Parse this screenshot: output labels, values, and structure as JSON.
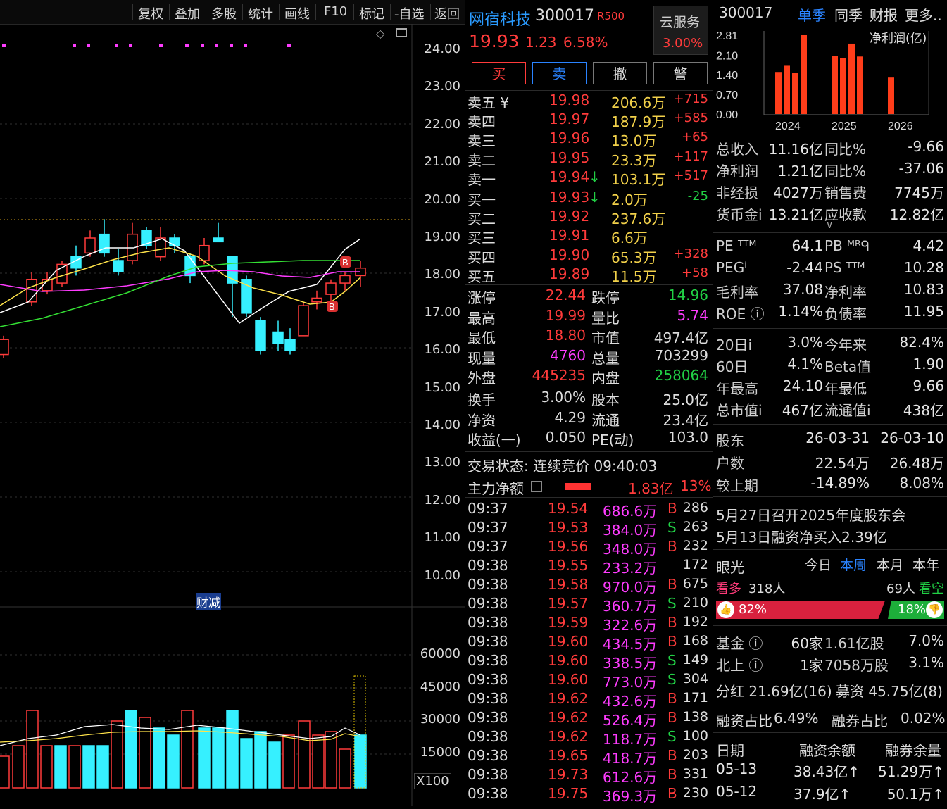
{
  "toolbar": {
    "items": [
      "复权",
      "叠加",
      "多股",
      "统计",
      "画线",
      "F10",
      "标记",
      "-自选",
      "返回"
    ]
  },
  "chart": {
    "price_ticks": [
      "24.00",
      "23.00",
      "22.00",
      "21.00",
      "20.00",
      "19.00",
      "18.00",
      "17.00",
      "16.00",
      "15.00",
      "14.00",
      "13.00",
      "12.00",
      "11.00",
      "10.00"
    ],
    "volume_ticks": [
      "60000",
      "45000",
      "30000",
      "15000"
    ],
    "volume_unit": "X100",
    "event_label": "财减",
    "markers": [
      "B",
      "B"
    ],
    "colors": {
      "up": "#ff3b3b",
      "down": "#36f0ff",
      "ma5": "#ffffff",
      "ma10": "#ffe34a",
      "ma20": "#ff3cff",
      "ma60": "#34e034"
    }
  },
  "quote": {
    "name": "网宿科技",
    "code": "300017",
    "badge": "R500",
    "price": "19.93",
    "change": "1.23",
    "change_pct": "6.58%",
    "cloud_label": "云服务",
    "cloud_pct": "3.00%",
    "buttons": [
      "买",
      "卖",
      "撤",
      "警"
    ],
    "asks": [
      {
        "label": "卖五 ¥",
        "price": "19.98",
        "vol": "206.6万",
        "chg": "+715",
        "arrow": ""
      },
      {
        "label": "卖四",
        "price": "19.97",
        "vol": "187.9万",
        "chg": "+585",
        "arrow": ""
      },
      {
        "label": "卖三",
        "price": "19.96",
        "vol": "13.0万",
        "chg": "+65",
        "arrow": ""
      },
      {
        "label": "卖二",
        "price": "19.95",
        "vol": "23.3万",
        "chg": "+117",
        "arrow": ""
      },
      {
        "label": "卖一",
        "price": "19.94",
        "vol": "103.1万",
        "chg": "+517",
        "arrow": "↓"
      }
    ],
    "bids": [
      {
        "label": "买一",
        "price": "19.93",
        "vol": "2.0万",
        "chg": "-25",
        "arrow": "↓"
      },
      {
        "label": "买二",
        "price": "19.92",
        "vol": "237.6万",
        "chg": "",
        "arrow": ""
      },
      {
        "label": "买三",
        "price": "19.91",
        "vol": "6.6万",
        "chg": "",
        "arrow": ""
      },
      {
        "label": "买四",
        "price": "19.90",
        "vol": "65.3万",
        "chg": "+328",
        "arrow": ""
      },
      {
        "label": "买五",
        "price": "19.89",
        "vol": "11.5万",
        "chg": "+58",
        "arrow": ""
      }
    ],
    "stats": [
      [
        "涨停",
        "22.44",
        "跌停",
        "14.96"
      ],
      [
        "最高",
        "19.99",
        "量比",
        "5.74"
      ],
      [
        "最低",
        "18.80",
        "市值",
        "497.4亿"
      ],
      [
        "现量",
        "4760",
        "总量",
        "703299"
      ],
      [
        "外盘",
        "445235",
        "内盘",
        "258064"
      ]
    ],
    "stats2": [
      [
        "换手",
        "3.00%",
        "股本",
        "25.0亿"
      ],
      [
        "净资",
        "4.29",
        "流通",
        "23.4亿"
      ],
      [
        "收益(一)",
        "0.050",
        "PE(动)",
        "103.0"
      ]
    ],
    "trade_status": "交易状态: 连续竞价 09:40:03",
    "main_flow_label": "主力净额",
    "main_flow_value": "1.83亿",
    "main_flow_pct": "13%",
    "ticks": [
      [
        "09:37",
        "19.54",
        "686.6万",
        "B",
        "286"
      ],
      [
        "09:37",
        "19.53",
        "384.0万",
        "S",
        "263"
      ],
      [
        "09:37",
        "19.56",
        "348.0万",
        "B",
        "232"
      ],
      [
        "09:38",
        "19.55",
        "233.2万",
        "",
        "172"
      ],
      [
        "09:38",
        "19.58",
        "970.0万",
        "B",
        "675"
      ],
      [
        "09:38",
        "19.57",
        "360.7万",
        "S",
        "210"
      ],
      [
        "09:38",
        "19.59",
        "322.6万",
        "B",
        "192"
      ],
      [
        "09:38",
        "19.60",
        "434.5万",
        "B",
        "168"
      ],
      [
        "09:38",
        "19.60",
        "338.5万",
        "S",
        "149"
      ],
      [
        "09:38",
        "19.60",
        "773.0万",
        "S",
        "304"
      ],
      [
        "09:38",
        "19.62",
        "432.6万",
        "B",
        "171"
      ],
      [
        "09:38",
        "19.62",
        "526.4万",
        "B",
        "138"
      ],
      [
        "09:38",
        "19.62",
        "118.7万",
        "S",
        "100"
      ],
      [
        "09:38",
        "19.65",
        "418.7万",
        "B",
        "203"
      ],
      [
        "09:38",
        "19.73",
        "612.6万",
        "B",
        "331"
      ],
      [
        "09:38",
        "19.75",
        "369.3万",
        "B",
        "230"
      ]
    ]
  },
  "fin": {
    "code": "300017",
    "tabs": [
      "单季",
      "同季",
      "财报",
      "更多.."
    ],
    "chart_label": "净利润(亿)",
    "y_ticks": [
      "2.81",
      "2.10",
      "1.40",
      "0.70",
      "0.00"
    ],
    "x_ticks": [
      "2024",
      "2025",
      "2026"
    ],
    "rows": [
      [
        "总收入",
        "11.16亿",
        "同比%",
        "-9.66"
      ],
      [
        "净利润",
        "1.21亿",
        "同比%",
        "-37.06"
      ],
      [
        "非经损",
        "4027万",
        "销售费",
        "7745万"
      ],
      [
        "货币金i",
        "13.21亿",
        "应收款",
        "12.82亿"
      ]
    ],
    "val_rows": [
      [
        "PE ᵀᵀᴹ",
        "64.1",
        "PB ᴹᴿᑫ",
        "4.42"
      ],
      [
        "PEGⁱ",
        "-2.44",
        "PS ᵀᵀᴹ",
        "10.28"
      ],
      [
        "毛利率",
        "37.08",
        "净利率",
        "10.83"
      ],
      [
        "ROE ⓘ",
        "1.14%",
        "负债率",
        "11.95"
      ]
    ],
    "perf_rows": [
      [
        "20日i",
        "3.0%",
        "今年来",
        "82.4%"
      ],
      [
        "60日",
        "4.1%",
        "Beta值",
        "1.90"
      ],
      [
        "年最高",
        "24.10",
        "年最低",
        "9.66"
      ],
      [
        "总市值i",
        "467亿",
        "流通值i",
        "438亿"
      ]
    ],
    "holders": [
      [
        "股东",
        "26-03-31",
        "26-03-10"
      ],
      [
        "户数",
        "22.54万",
        "26.48万"
      ],
      [
        "较上期",
        "-14.89%",
        "8.08%"
      ]
    ],
    "news": [
      "5月27日召开2025年度股东会",
      "5月13日融资净买入2.39亿"
    ],
    "eye_label": "眼光",
    "eye_tabs": [
      "今日",
      "本周",
      "本月",
      "本年"
    ],
    "bull_label": "看多",
    "bull_count": "318人",
    "bear_count": "69人",
    "bear_label": "看空",
    "bull_pct": "82%",
    "bear_pct": "18%",
    "funds": [
      [
        "基金 ⓘ",
        "60家",
        "1.61亿股",
        "7.0%"
      ],
      [
        "北上 ⓘ",
        "1家",
        "7058万股",
        "3.1%"
      ]
    ],
    "dividend": "分红 21.69亿(16)",
    "raise": "募资 45.75亿(8)",
    "margin_pct_label": "融资占比",
    "margin_pct": "6.49%",
    "short_pct_label": "融券占比",
    "short_pct": "0.02%",
    "margin_head": [
      "日期",
      "融资余额",
      "融券余量"
    ],
    "margin_rows": [
      [
        "05-13",
        "38.43亿↑",
        "51.29万↑"
      ],
      [
        "05-12",
        "37.9亿↑",
        "50.1万↑"
      ]
    ]
  },
  "chart_data": [
    {
      "type": "bar",
      "title": "净利润(亿)",
      "categories": [
        "2024",
        "2024",
        "2024",
        "2024",
        "2025",
        "2025",
        "2025",
        "2025",
        "2026"
      ],
      "values": [
        1.5,
        1.72,
        1.46,
        2.81,
        2.08,
        2.0,
        2.51,
        2.05,
        1.3
      ],
      "ylim": [
        0,
        2.81
      ]
    }
  ]
}
